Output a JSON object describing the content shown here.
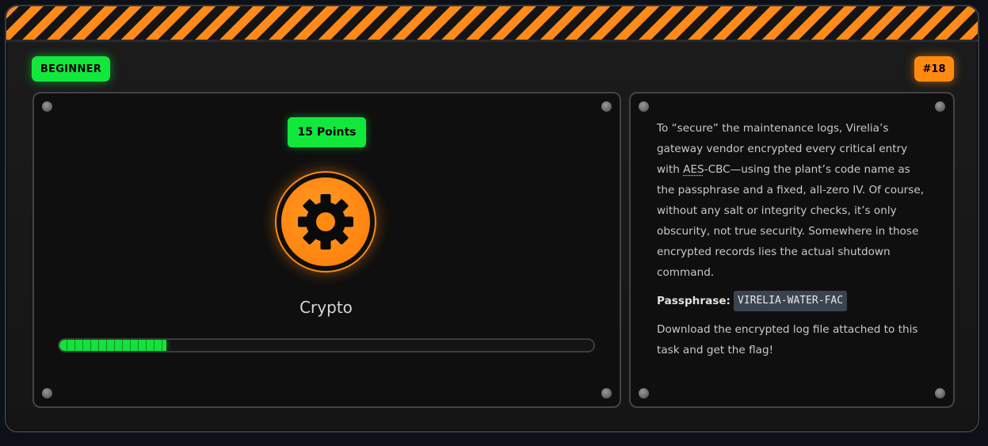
{
  "challenge": {
    "level_badge": "BEGINNER",
    "number_badge": "#18",
    "points_label": "15 Points",
    "category": "Crypto",
    "progress": 0.2,
    "icon": "gear-icon",
    "colors": {
      "accent_orange": "#ff8a10",
      "accent_green": "#12e83c",
      "background": "#151515"
    }
  },
  "description": {
    "para1_before": "To “secure” the maintenance logs, Virelia’s gateway vendor encrypted every critical entry with ",
    "para1_abbr": "AES",
    "para1_after": "-CBC—using the plant’s code name as the passphrase and a fixed, all-zero IV. Of course, without any salt or integrity checks, it’s only obscurity, not true security. Somewhere in those encrypted records lies the actual shutdown command.",
    "passphrase_label": "Passphrase:",
    "passphrase_value": "VIRELIA-WATER-FAC",
    "para3": "Download the encrypted log file attached to this task and get the flag!"
  }
}
